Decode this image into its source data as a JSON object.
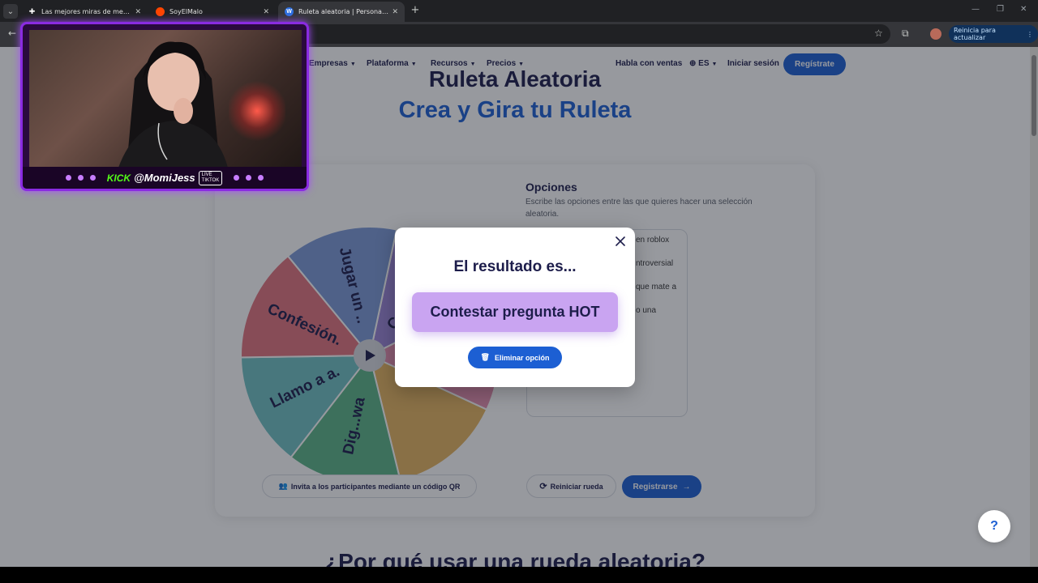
{
  "browser": {
    "tabs": [
      {
        "title": "Las mejores miras de memes de",
        "active": false
      },
      {
        "title": "SoyElMalo",
        "active": false
      },
      {
        "title": "Ruleta aleatoria | Personaliza y",
        "active": true
      }
    ],
    "update_label": "Reinicia para actualizar"
  },
  "nav": {
    "items": [
      "Empresas",
      "Plataforma",
      "Recursos",
      "Precios"
    ],
    "talk_sales": "Habla con ventas",
    "language": "ES",
    "login": "Iniciar sesión",
    "register": "Regístrate"
  },
  "hero": {
    "title": "Ruleta Aleatoria",
    "subtitle": "Crea y Gira tu Ruleta"
  },
  "wheel": {
    "segments": [
      {
        "label": "Contestar.",
        "color": "#9b86d8"
      },
      {
        "label": "",
        "color": "#e58fb0"
      },
      {
        "label": "",
        "color": "#e6b45f"
      },
      {
        "label": "Dig...wa",
        "color": "#5bb587"
      },
      {
        "label": "Llamo a a.",
        "color": "#6fc1c4"
      },
      {
        "label": "Confesión.",
        "color": "#e2737e"
      },
      {
        "label": "Jugar un ..",
        "color": "#7c9ad8"
      }
    ]
  },
  "options": {
    "title": "Opciones",
    "description": "Escribe las opciones entre las que quieres hacer una selección aleatoria.",
    "visible_lines": [
      "en roblox",
      "ntroversial",
      "que mate a",
      "o una"
    ]
  },
  "actions": {
    "qr_label": "Invita a los participantes mediante un código QR",
    "reset_label": "Reiniciar rueda",
    "signup_label": "Registrarse"
  },
  "section": {
    "next_title": "¿Por qué usar una rueda aleatoria?"
  },
  "modal": {
    "title": "El resultado es...",
    "result": "Contestar pregunta HOT",
    "delete_label": "Eliminar opción"
  },
  "help": {
    "label": "?"
  },
  "stream": {
    "kick": "KICK",
    "handle": "@MomiJess",
    "tiktok_top": "LIVE",
    "tiktok_bottom": "TIKTOK"
  },
  "colors": {
    "brand_blue": "#1c5fd3",
    "navy": "#1d1d4b",
    "result_purple": "#c9a4f1"
  }
}
